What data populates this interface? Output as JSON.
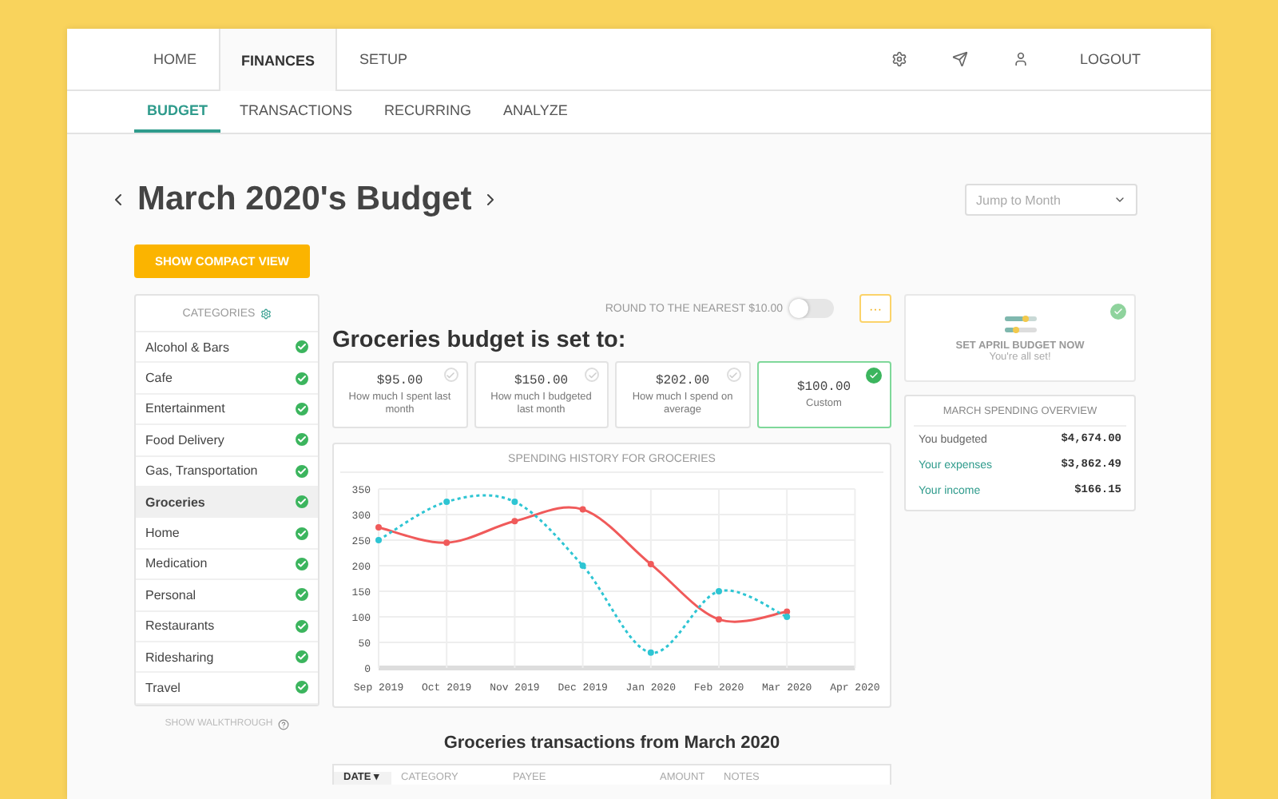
{
  "top_nav": {
    "tabs": [
      {
        "label": "HOME",
        "selected": false
      },
      {
        "label": "FINANCES",
        "selected": true
      },
      {
        "label": "SETUP",
        "selected": false
      }
    ],
    "logout": "LOGOUT"
  },
  "sub_nav": {
    "tabs": [
      {
        "label": "BUDGET",
        "selected": true
      },
      {
        "label": "TRANSACTIONS",
        "selected": false
      },
      {
        "label": "RECURRING",
        "selected": false
      },
      {
        "label": "ANALYZE",
        "selected": false
      }
    ]
  },
  "title": "March 2020's Budget",
  "jump_to_month": {
    "placeholder": "Jump to Month"
  },
  "compact_button": "SHOW COMPACT VIEW",
  "categories": {
    "title": "CATEGORIES",
    "items": [
      {
        "label": "Alcohol & Bars",
        "checked": true,
        "selected": false
      },
      {
        "label": "Cafe",
        "checked": true,
        "selected": false
      },
      {
        "label": "Entertainment",
        "checked": true,
        "selected": false
      },
      {
        "label": "Food Delivery",
        "checked": true,
        "selected": false
      },
      {
        "label": "Gas, Transportation",
        "checked": true,
        "selected": false
      },
      {
        "label": "Groceries",
        "checked": true,
        "selected": true
      },
      {
        "label": "Home",
        "checked": true,
        "selected": false
      },
      {
        "label": "Medication",
        "checked": true,
        "selected": false
      },
      {
        "label": "Personal",
        "checked": true,
        "selected": false
      },
      {
        "label": "Restaurants",
        "checked": true,
        "selected": false
      },
      {
        "label": "Ridesharing",
        "checked": true,
        "selected": false
      },
      {
        "label": "Travel",
        "checked": true,
        "selected": false
      }
    ],
    "walkthrough": "SHOW WALKTHROUGH"
  },
  "round_toggle": {
    "label": "ROUND TO THE NEAREST $10.00",
    "on": false
  },
  "more_button": "···",
  "budget_heading": "Groceries budget is set to:",
  "budget_options": [
    {
      "amount": "$95.00",
      "caption": "How much I spent last month",
      "selected": false
    },
    {
      "amount": "$150.00",
      "caption": "How much I budgeted last month",
      "selected": false
    },
    {
      "amount": "$202.00",
      "caption": "How much I spend on average",
      "selected": false
    },
    {
      "amount": "$100.00",
      "caption": "Custom",
      "selected": true
    }
  ],
  "history": {
    "chart_data": {
      "type": "line",
      "title": "SPENDING HISTORY FOR GROCERIES",
      "categories": [
        "Sep 2019",
        "Oct 2019",
        "Nov 2019",
        "Dec 2019",
        "Jan 2020",
        "Feb 2020",
        "Mar 2020",
        "Apr 2020"
      ],
      "series": [
        {
          "color": "#f05a5a",
          "line_style": "solid",
          "marker": "circle",
          "values": [
            275,
            245,
            287,
            310,
            203,
            95,
            110,
            null
          ]
        },
        {
          "color": "#2ec5d3",
          "line_style": "dashed",
          "marker": "circle",
          "values": [
            250,
            325,
            325,
            200,
            30,
            150,
            100,
            null
          ]
        }
      ],
      "grid": true,
      "ylim": [
        0,
        350
      ],
      "yticks": [
        0,
        50,
        100,
        150,
        200,
        250,
        300,
        350
      ]
    }
  },
  "april_card": {
    "title": "SET APRIL BUDGET NOW",
    "subtitle": "You're all set!",
    "done": true
  },
  "overview": {
    "title": "MARCH SPENDING OVERVIEW",
    "rows": [
      {
        "label": "You budgeted",
        "value": "$4,674.00",
        "kind": "plain"
      },
      {
        "label": "Your expenses",
        "value": "$3,862.49",
        "kind": "accent"
      },
      {
        "label": "Your income",
        "value": "$166.15",
        "kind": "accent"
      }
    ]
  },
  "transactions": {
    "title": "Groceries transactions from March 2020",
    "columns": [
      {
        "label": "DATE ▾",
        "selected": true
      },
      {
        "label": "CATEGORY",
        "selected": false
      },
      {
        "label": "PAYEE",
        "selected": false
      },
      {
        "label": "AMOUNT",
        "selected": false
      },
      {
        "label": "NOTES",
        "selected": false
      }
    ]
  }
}
